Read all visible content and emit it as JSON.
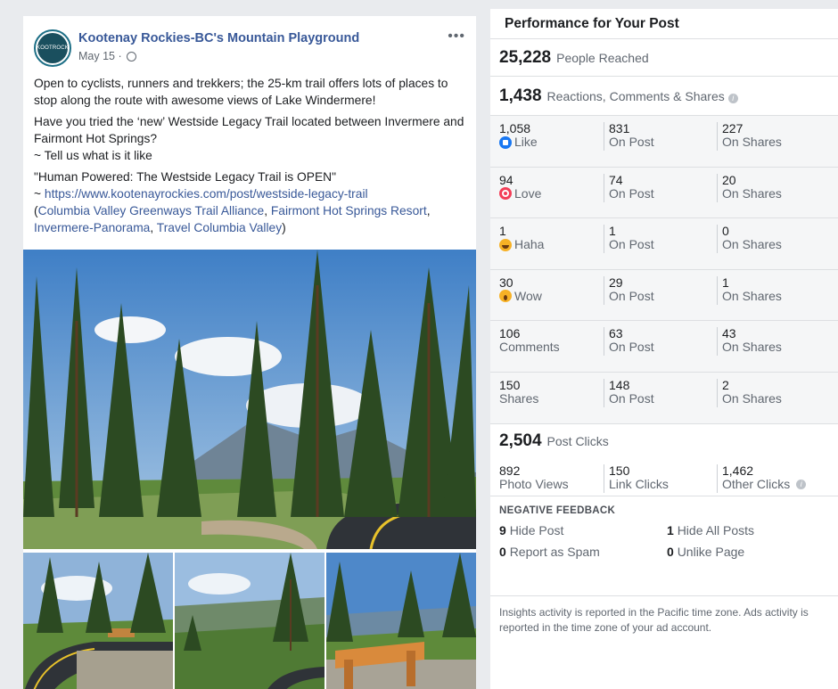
{
  "post": {
    "page_name": "Kootenay Rockies-BC's Mountain Playground",
    "avatar_text": "KOOTROCK",
    "date": "May 15 ·",
    "more_label": "•••",
    "p1": "Open to cyclists, runners and trekkers; the 25-km trail offers lots of places to stop along the route with awesome views of Lake Windermere!",
    "p2": "Have you tried the ‘new’ Westside Legacy Trail located between Invermere and Fairmont Hot Springs?",
    "p3": "~ Tell us what is it like",
    "p4": "\"Human Powered: The Westside Legacy Trail is OPEN\"",
    "p5_prefix": "~ ",
    "link_url": "https://www.kootenayrockies.com/post/westside-legacy-trail",
    "tag_open": "(",
    "tag1": "Columbia Valley Greenways Trail Alliance",
    "sep1": ", ",
    "tag2": "Fairmont Hot Springs Resort",
    "sep2": ",",
    "tag3": "Invermere-Panorama",
    "sep3": ", ",
    "tag4": "Travel Columbia Valley",
    "tag_close": ")"
  },
  "insights": {
    "title": "Performance for Your Post",
    "reached_num": "25,228",
    "reached_label": "People Reached",
    "engagement_num": "1,438",
    "engagement_label": "Reactions, Comments & Shares",
    "rows": [
      {
        "c1_num": "1,058",
        "c1_label": "Like",
        "c2_num": "831",
        "c2_label": "On Post",
        "c3_num": "227",
        "c3_label": "On Shares"
      },
      {
        "c1_num": "94",
        "c1_label": "Love",
        "c2_num": "74",
        "c2_label": "On Post",
        "c3_num": "20",
        "c3_label": "On Shares"
      },
      {
        "c1_num": "1",
        "c1_label": "Haha",
        "c2_num": "1",
        "c2_label": "On Post",
        "c3_num": "0",
        "c3_label": "On Shares"
      },
      {
        "c1_num": "30",
        "c1_label": "Wow",
        "c2_num": "29",
        "c2_label": "On Post",
        "c3_num": "1",
        "c3_label": "On Shares"
      },
      {
        "c1_num": "106",
        "c1_label": "Comments",
        "c2_num": "63",
        "c2_label": "On Post",
        "c3_num": "43",
        "c3_label": "On Shares"
      },
      {
        "c1_num": "150",
        "c1_label": "Shares",
        "c2_num": "148",
        "c2_label": "On Post",
        "c3_num": "2",
        "c3_label": "On Shares"
      }
    ],
    "clicks_num": "2,504",
    "clicks_label": "Post Clicks",
    "photo_views_num": "892",
    "photo_views_label": "Photo Views",
    "link_clicks_num": "150",
    "link_clicks_label": "Link Clicks",
    "other_clicks_num": "1,462",
    "other_clicks_label": "Other Clicks",
    "negative_title": "NEGATIVE FEEDBACK",
    "hide_post_num": "9",
    "hide_post_label": "Hide Post",
    "hide_all_num": "1",
    "hide_all_label": "Hide All Posts",
    "spam_num": "0",
    "spam_label": "Report as Spam",
    "unlike_num": "0",
    "unlike_label": "Unlike Page",
    "footnote": "Insights activity is reported in the Pacific time zone. Ads activity is reported in the time zone of your ad account."
  },
  "colors": {
    "link": "#385898",
    "like": "#1877f2",
    "love": "#f33e58",
    "haha_wow": "#f7b125"
  },
  "icons": [
    "globe-icon",
    "more-icon",
    "like-icon",
    "love-icon",
    "haha-icon",
    "wow-icon",
    "info-icon"
  ]
}
